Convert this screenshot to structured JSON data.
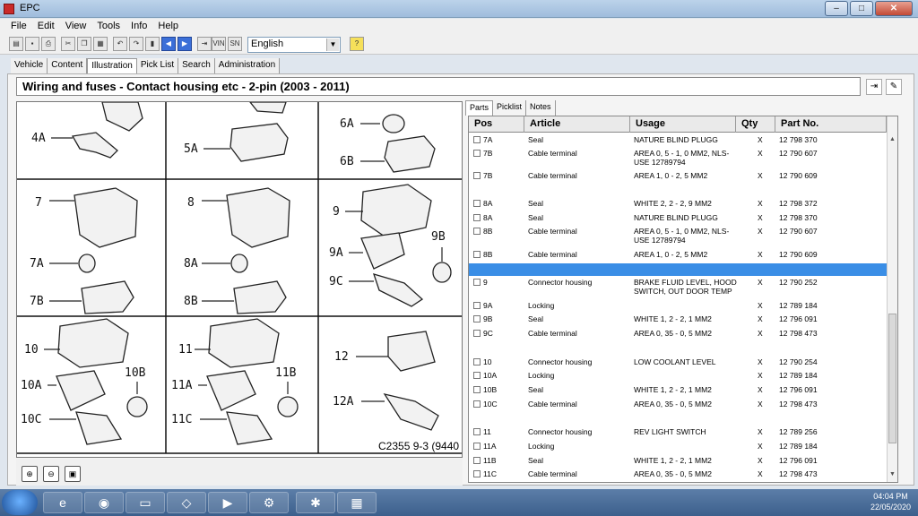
{
  "window": {
    "title": "EPC"
  },
  "menu": [
    "File",
    "Edit",
    "View",
    "Tools",
    "Info",
    "Help"
  ],
  "toolbar": {
    "language": "English",
    "vin_label": "VIN",
    "sn_label": "SN"
  },
  "tabs": [
    "Vehicle",
    "Content",
    "Illustration",
    "Pick List",
    "Search",
    "Administration"
  ],
  "active_tab": "Illustration",
  "heading": "Wiring and fuses - Contact housing etc - 2-pin   (2003 - 2011)",
  "illustration": {
    "labels": [
      "4A",
      "5A",
      "6A",
      "6B",
      "7",
      "7A",
      "7B",
      "8",
      "8A",
      "8B",
      "9",
      "9A",
      "9B",
      "9C",
      "10",
      "10A",
      "10B",
      "10C",
      "11",
      "11A",
      "11B",
      "11C",
      "12",
      "12A"
    ],
    "code": "C2355 9-3 (9440"
  },
  "parts_tabs": [
    "Parts",
    "Picklist",
    "Notes"
  ],
  "columns": {
    "pos": "Pos",
    "article": "Article",
    "usage": "Usage",
    "qty": "Qty",
    "part_no": "Part No."
  },
  "rows": [
    {
      "pos": "7A",
      "article": "Seal",
      "usage": "NATURE BLIND PLUGG",
      "qty": "X",
      "part_no": "12 798 370"
    },
    {
      "pos": "7B",
      "article": "Cable terminal",
      "usage": "AREA 0, 5 - 1, 0 MM2, NLS-USE 12789794",
      "qty": "X",
      "part_no": "12 790 607"
    },
    {
      "pos": "7B",
      "article": "Cable terminal",
      "usage": "AREA 1, 0 - 2, 5 MM2",
      "qty": "X",
      "part_no": "12 790 609"
    },
    {
      "pos": "8A",
      "article": "Seal",
      "usage": "WHITE 2, 2 - 2, 9 MM2",
      "qty": "X",
      "part_no": "12 798 372"
    },
    {
      "pos": "8A",
      "article": "Seal",
      "usage": "NATURE BLIND PLUGG",
      "qty": "X",
      "part_no": "12 798 370"
    },
    {
      "pos": "8B",
      "article": "Cable terminal",
      "usage": "AREA 0, 5 - 1, 0 MM2, NLS-USE 12789794",
      "qty": "X",
      "part_no": "12 790 607"
    },
    {
      "pos": "8B",
      "article": "Cable terminal",
      "usage": "AREA 1, 0 - 2, 5 MM2",
      "qty": "X",
      "part_no": "12 790 609"
    },
    {
      "pos": "9",
      "article": "Connector housing",
      "usage": "BRAKE FLUID LEVEL, HOOD SWITCH, OUT DOOR TEMP",
      "qty": "X",
      "part_no": "12 790 252"
    },
    {
      "pos": "9A",
      "article": "Locking",
      "usage": "",
      "qty": "X",
      "part_no": "12 789 184"
    },
    {
      "pos": "9B",
      "article": "Seal",
      "usage": "WHITE 1, 2 - 2, 1 MM2",
      "qty": "X",
      "part_no": "12 796 091"
    },
    {
      "pos": "9C",
      "article": "Cable terminal",
      "usage": "AREA 0, 35 - 0, 5 MM2",
      "qty": "X",
      "part_no": "12 798 473"
    },
    {
      "pos": "10",
      "article": "Connector housing",
      "usage": "LOW COOLANT LEVEL",
      "qty": "X",
      "part_no": "12 790 254"
    },
    {
      "pos": "10A",
      "article": "Locking",
      "usage": "",
      "qty": "X",
      "part_no": "12 789 184"
    },
    {
      "pos": "10B",
      "article": "Seal",
      "usage": "WHITE 1, 2 - 2, 1 MM2",
      "qty": "X",
      "part_no": "12 796 091"
    },
    {
      "pos": "10C",
      "article": "Cable terminal",
      "usage": "AREA 0, 35 - 0, 5 MM2",
      "qty": "X",
      "part_no": "12 798 473"
    },
    {
      "pos": "11",
      "article": "Connector housing",
      "usage": "REV LIGHT SWITCH",
      "qty": "X",
      "part_no": "12 789 256"
    },
    {
      "pos": "11A",
      "article": "Locking",
      "usage": "",
      "qty": "X",
      "part_no": "12 789 184"
    },
    {
      "pos": "11B",
      "article": "Seal",
      "usage": "WHITE 1, 2 - 2, 1 MM2",
      "qty": "X",
      "part_no": "12 796 091"
    },
    {
      "pos": "11C",
      "article": "Cable terminal",
      "usage": "AREA 0, 35 - 0, 5 MM2",
      "qty": "X",
      "part_no": "12 798 473"
    }
  ],
  "taskbar": {
    "time": "04:04 PM",
    "date": "22/05/2020"
  },
  "colors": {
    "selection": "#3a8ee6",
    "taskbar": "#3c5f8c"
  }
}
